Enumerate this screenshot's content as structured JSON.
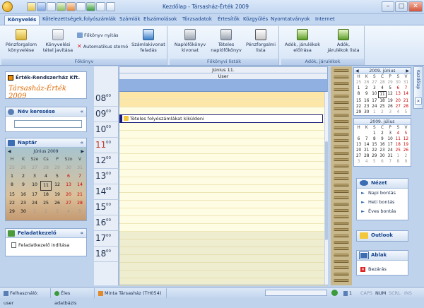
{
  "window": {
    "title": "Kezdőlap - Társasház-Érték 2009"
  },
  "tabs": [
    "Könyvelés",
    "Kötelezettségek,folyószámlák",
    "Számlák",
    "Elszámolások",
    "Törzsadatok",
    "Értesítők",
    "Közgyűlés",
    "Nyomtatványok",
    "Internet"
  ],
  "ribbon": {
    "konyv": {
      "label": "Főkönyv",
      "b1": [
        "Pénzforgalom",
        "könyvelése"
      ],
      "b2": [
        "Könyvelési",
        "tétel javítása"
      ],
      "s1": "Főkönyv nyitás",
      "s2": "Automatikus stornó",
      "b3": [
        "Számlakivonat",
        "feladás"
      ]
    },
    "lists": {
      "label": "Főkönyvi listák",
      "b1": [
        "Naplófőkönyv",
        "kivonat"
      ],
      "b2": [
        "Tételes",
        "naplófőkönyv"
      ],
      "b3": [
        "Pénzforgalmi",
        "lista"
      ]
    },
    "taxes": {
      "label": "Adók, járulékok",
      "b1": [
        "Adók, járulékok",
        "előírása"
      ],
      "b2": [
        "Adók,",
        "járulékok lista"
      ]
    }
  },
  "left": {
    "company": "Érték-Rendszerház Kft.",
    "logo_text": "Társasház-Érték 2009",
    "search_title": "Név keresése",
    "search_value": "",
    "calendar_title": "Naptár",
    "calendar_month": "Június 2009",
    "calendar_days": [
      "H",
      "K",
      "Sze",
      "Cs",
      "P",
      "Szo",
      "V"
    ],
    "calendar_weeks": [
      [
        "25",
        "26",
        "27",
        "28",
        "29",
        "30",
        "31"
      ],
      [
        "1",
        "2",
        "3",
        "4",
        "5",
        "6",
        "7"
      ],
      [
        "8",
        "9",
        "10",
        "11",
        "12",
        "13",
        "14"
      ],
      [
        "15",
        "16",
        "17",
        "18",
        "19",
        "20",
        "21"
      ],
      [
        "22",
        "23",
        "24",
        "25",
        "26",
        "27",
        "28"
      ],
      [
        "29",
        "30",
        "1",
        "2",
        "3",
        "4",
        "5"
      ]
    ],
    "tasks_title": "Feladatkezelő",
    "tasks_item": "Feladatkezelő indítása"
  },
  "calendar": {
    "date": "Június 11.",
    "user": "User",
    "hours": [
      "08",
      "09",
      "10",
      "11",
      "12",
      "13",
      "14",
      "15",
      "16",
      "17",
      "18"
    ],
    "minutes": "00",
    "event": "Tételes folyószámlákat kiküldeni"
  },
  "minical1": {
    "month": "2009. június",
    "days": [
      "H",
      "K",
      "S",
      "C",
      "P",
      "S",
      "V"
    ],
    "weeks": [
      [
        "25",
        "26",
        "27",
        "28",
        "29",
        "30",
        "31"
      ],
      [
        "1",
        "2",
        "3",
        "4",
        "5",
        "6",
        "7"
      ],
      [
        "8",
        "9",
        "10",
        "11",
        "12",
        "13",
        "14"
      ],
      [
        "15",
        "16",
        "17",
        "18",
        "19",
        "20",
        "21"
      ],
      [
        "22",
        "23",
        "24",
        "25",
        "26",
        "27",
        "28"
      ],
      [
        "29",
        "30",
        "1",
        "2",
        "3",
        "4",
        "5"
      ]
    ]
  },
  "minical2": {
    "month": "2009. július",
    "days": [
      "H",
      "K",
      "S",
      "C",
      "P",
      "S",
      "V"
    ],
    "weeks": [
      [
        "",
        "",
        "1",
        "2",
        "3",
        "4",
        "5"
      ],
      [
        "6",
        "7",
        "8",
        "9",
        "10",
        "11",
        "12"
      ],
      [
        "13",
        "14",
        "15",
        "16",
        "17",
        "18",
        "19"
      ],
      [
        "20",
        "21",
        "22",
        "23",
        "24",
        "25",
        "26"
      ],
      [
        "27",
        "28",
        "29",
        "30",
        "31",
        "1",
        "2"
      ],
      [
        "3",
        "4",
        "5",
        "6",
        "7",
        "8",
        "9"
      ]
    ]
  },
  "view_panel": {
    "title": "Nézet",
    "items": [
      "Napi bontás",
      "Heti bontás",
      "Éves bontás"
    ]
  },
  "outlook_panel": {
    "title": "Outlook"
  },
  "window_panel": {
    "title": "Ablak",
    "close": "Bezárás"
  },
  "side_tab": "Kezdőlap",
  "status": {
    "user": "Felhasználó: user",
    "db": "Éles adatbázis",
    "house": "Minta Társasház (TH054)",
    "count": "1",
    "caps": "CAPS",
    "num": "NUM",
    "scrl": "SCRL",
    "ins": "INS"
  },
  "colors": {
    "accent": "#15428b",
    "event_bar": "#1a1a7a",
    "cal_bg": "#fffce4"
  }
}
